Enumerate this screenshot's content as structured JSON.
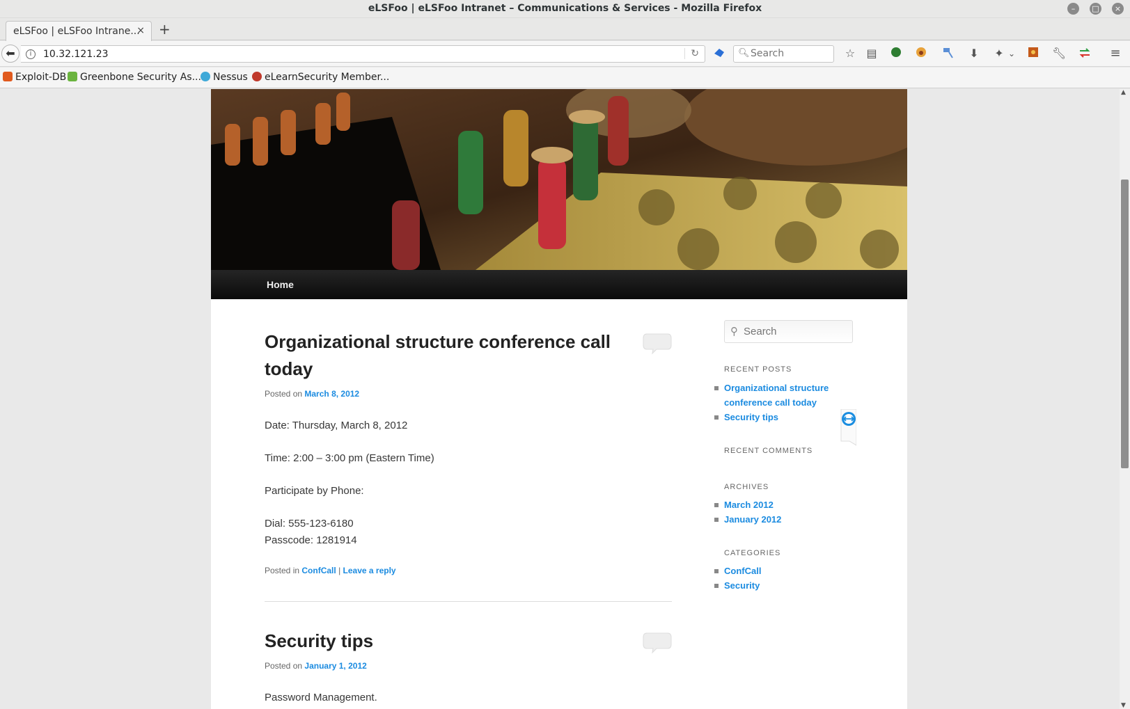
{
  "window": {
    "title": "eLSFoo | eLSFoo Intranet – Communications & Services - Mozilla Firefox"
  },
  "tab": {
    "title": "eLSFoo | eLSFoo Intrane...",
    "close": "×",
    "new": "+"
  },
  "navbar": {
    "url": "10.32.121.23",
    "search_placeholder": "Search"
  },
  "bookmarks": [
    {
      "label": "Exploit-DB",
      "color": "#e05a1e"
    },
    {
      "label": "Greenbone Security As...",
      "color": "#6bb43f"
    },
    {
      "label": "Nessus",
      "color": "#3fa9d8"
    },
    {
      "label": "eLearnSecurity Member...",
      "color": "#c0392b"
    }
  ],
  "site": {
    "nav": {
      "home": "Home"
    },
    "posts": [
      {
        "title": "Organizational structure conference call today",
        "posted_on_label": "Posted on",
        "date": "March 8, 2012",
        "content": [
          "Date: Thursday, March 8, 2012",
          "Time: 2:00 – 3:00 pm (Eastern Time)",
          "Participate by Phone:",
          "Dial: 555-123-6180",
          "Passcode: 1281914"
        ],
        "posted_in_label": "Posted in",
        "category": "ConfCall",
        "separator": "|",
        "reply": "Leave a reply"
      },
      {
        "title": "Security tips",
        "posted_on_label": "Posted on",
        "date": "January 1, 2012",
        "content": [
          "Password Management."
        ]
      }
    ],
    "sidebar": {
      "search_placeholder": "Search",
      "recent_posts_title": "RECENT POSTS",
      "recent_posts": [
        "Organizational structure conference call today",
        "Security tips"
      ],
      "recent_comments_title": "RECENT COMMENTS",
      "archives_title": "ARCHIVES",
      "archives": [
        "March 2012",
        "January 2012"
      ],
      "categories_title": "CATEGORIES",
      "categories": [
        "ConfCall",
        "Security"
      ]
    }
  }
}
